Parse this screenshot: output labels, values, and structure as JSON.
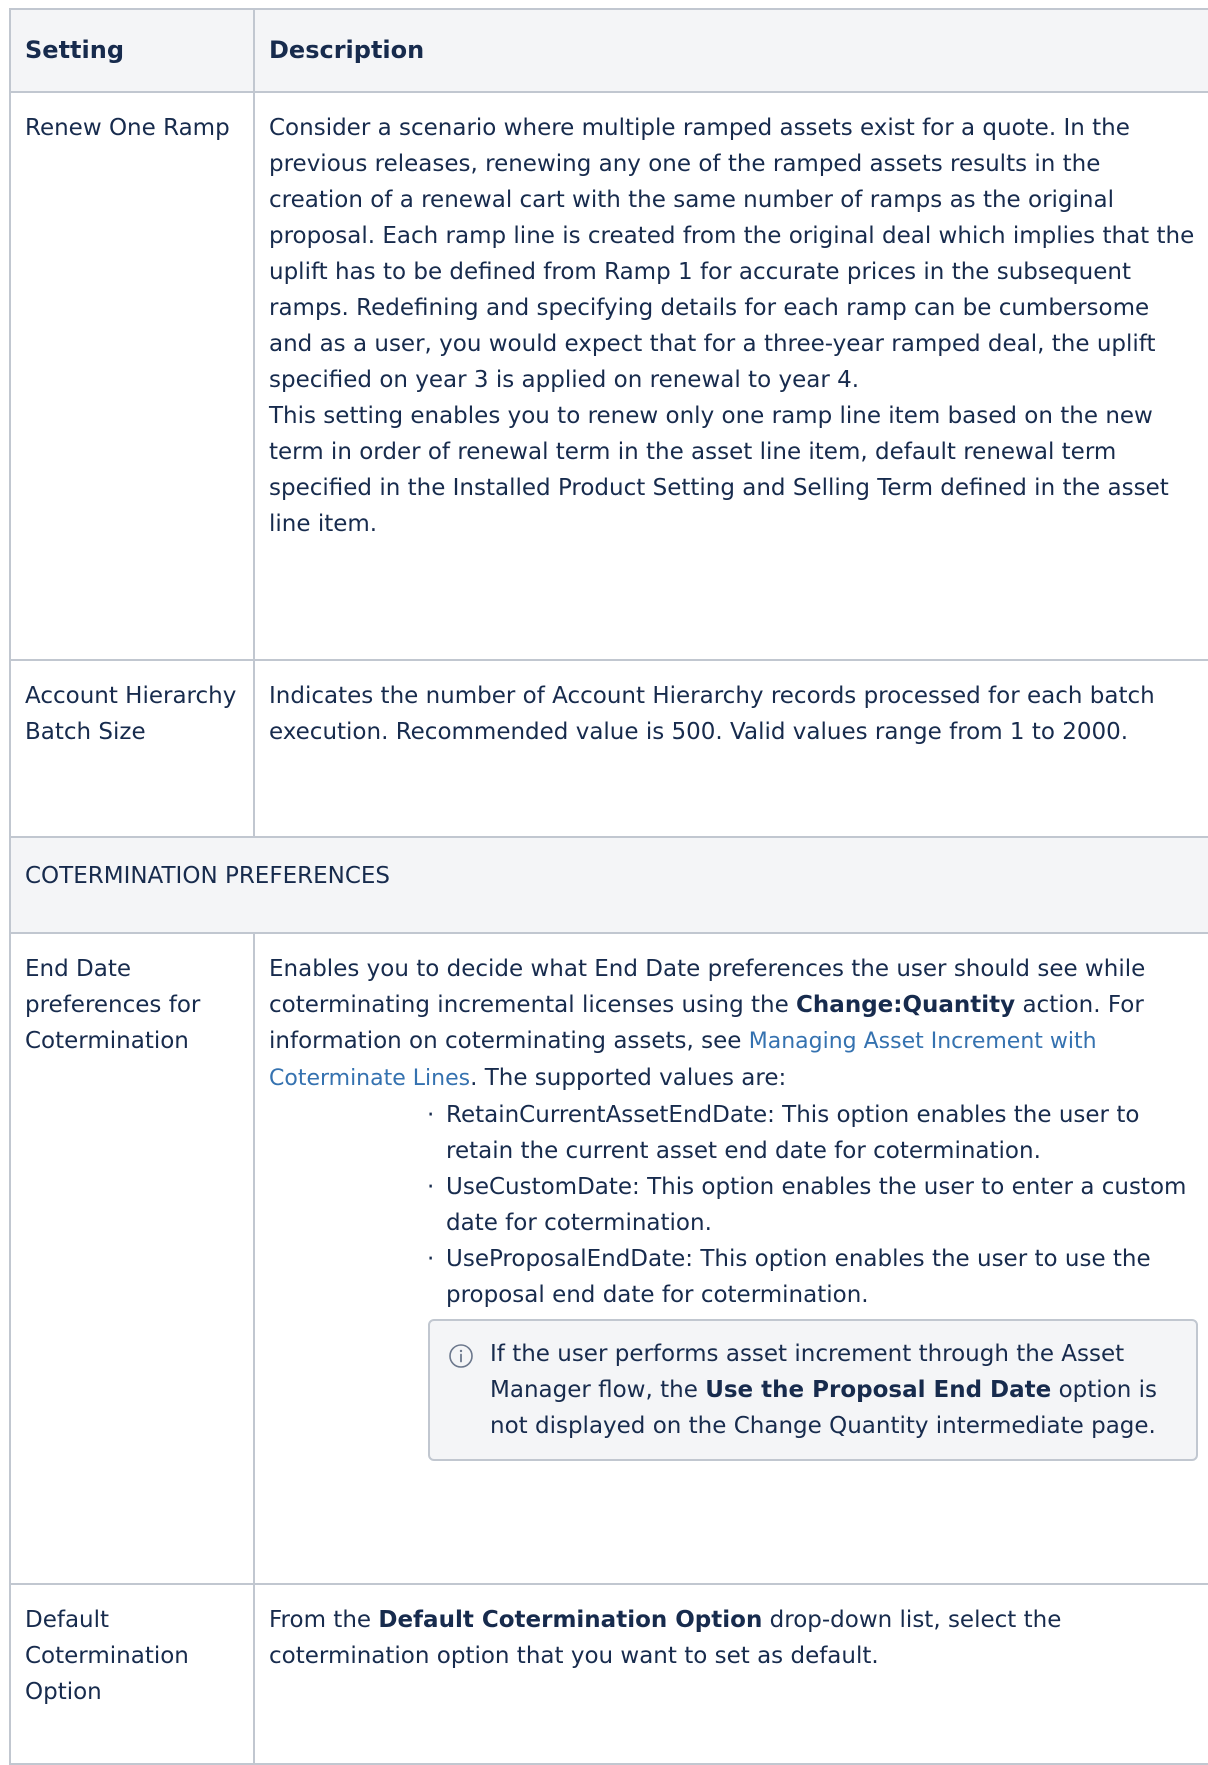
{
  "table": {
    "headers": {
      "setting": "Setting",
      "description": "Description"
    },
    "renew_one_ramp": {
      "setting": "Renew One Ramp",
      "paragraph1": "Consider a scenario where multiple ramped assets exist for a quote. In the previous releases, renewing any one of the ramped assets results in the creation of a renewal cart with the same number of ramps as the original proposal. Each ramp line is created from the original deal which implies that the uplift has to be defined from Ramp 1 for accurate prices in the subsequent ramps. Redefining and specifying details for each ramp can be cumbersome and as a user, you would expect that for a three-year ramped deal, the uplift specified on year 3 is applied on renewal to year 4.",
      "paragraph2": "This setting enables you to renew only one ramp line item based on the new term in order of renewal term in the asset line item, default renewal term specified in the Installed Product Setting and Selling Term defined in the asset line item."
    },
    "account_hierarchy_batch_size": {
      "setting": "Account Hierarchy Batch Size",
      "description": "Indicates the number of Account Hierarchy records processed for each batch execution. Recommended value is 500. Valid values range from 1 to 2000."
    },
    "section_coterminate": "COTERMINATION PREFERENCES",
    "end_date_preferences": {
      "setting": "End Date preferences for Cotermination",
      "desc_part1": "Enables you to decide what End Date preferences the user should see while coterminating incremental licenses using the ",
      "desc_bold": "Change:Quantity",
      "desc_part2": " action. For information on coterminating assets, see ",
      "desc_link": "Managing Asset Increment with Coterminate Lines",
      "desc_part3": ". The supported values are:",
      "values": [
        "RetainCurrentAssetEndDate: This option enables the user to retain the current asset end date for cotermination.",
        "UseCustomDate: This option enables the user to enter a custom date for cotermination.",
        "UseProposalEndDate: This option enables the user to use the proposal end date for cotermination."
      ],
      "info_part1": "If the user performs asset increment through the Asset Manager flow, the ",
      "info_bold": "Use the Proposal End Date",
      "info_part2": " option is not displayed on the Change Quantity intermediate page."
    },
    "default_cotermination_option": {
      "setting": "Default Cotermination Option",
      "desc_part1": "From the ",
      "desc_bold": "Default Cotermination Option",
      "desc_part2": " drop-down list, select the cotermination option that you want to set as default."
    }
  },
  "icons": {
    "info": "info-icon"
  },
  "colors": {
    "border": "#c1c7d0",
    "header_bg": "#f4f5f7",
    "text": "#172b4d",
    "link": "#3572b0"
  }
}
